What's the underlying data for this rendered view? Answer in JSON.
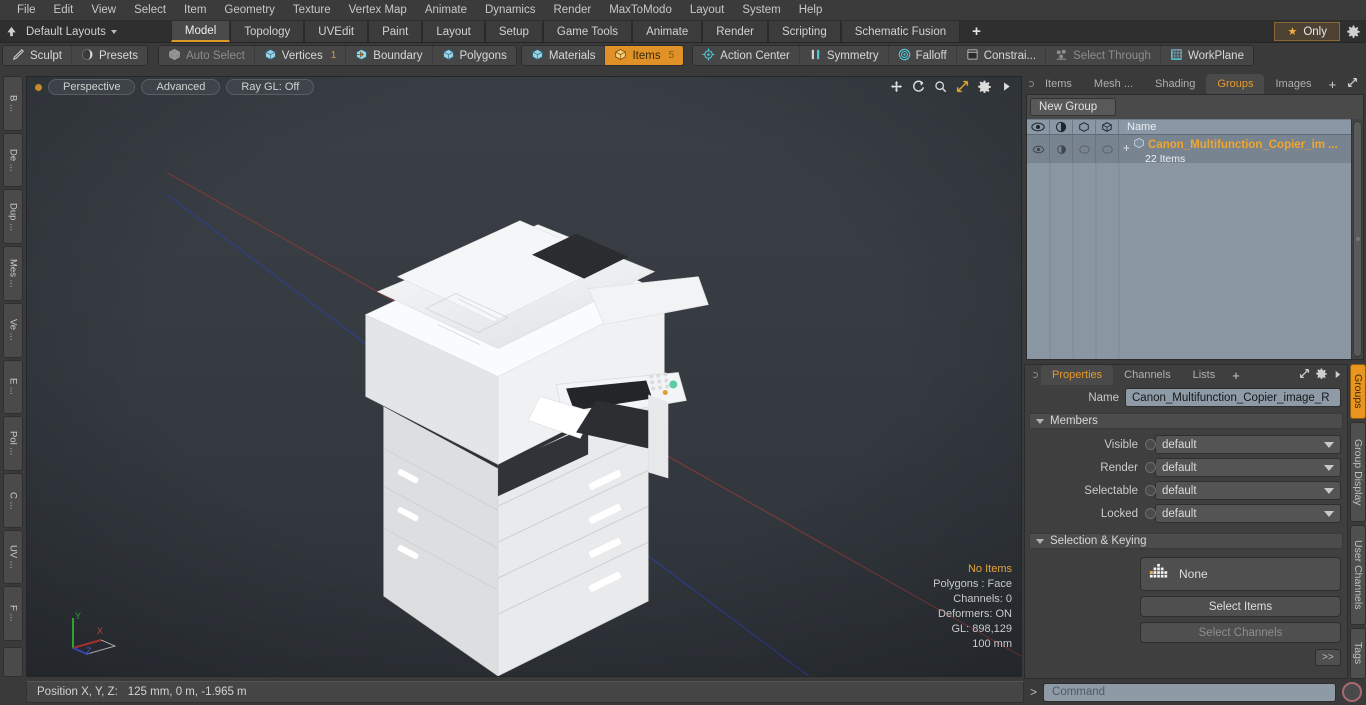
{
  "menubar": {
    "items": [
      "File",
      "Edit",
      "View",
      "Select",
      "Item",
      "Geometry",
      "Texture",
      "Vertex Map",
      "Animate",
      "Dynamics",
      "Render",
      "MaxToModo",
      "Layout",
      "System",
      "Help"
    ]
  },
  "layoutbar": {
    "preset_label": "Default Layouts",
    "tabs": [
      {
        "label": "Model",
        "active": true
      },
      {
        "label": "Topology",
        "active": false
      },
      {
        "label": "UVEdit",
        "active": false
      },
      {
        "label": "Paint",
        "active": false
      },
      {
        "label": "Layout",
        "active": false
      },
      {
        "label": "Setup",
        "active": false
      },
      {
        "label": "Game Tools",
        "active": false
      },
      {
        "label": "Animate",
        "active": false
      },
      {
        "label": "Render",
        "active": false
      },
      {
        "label": "Scripting",
        "active": false
      },
      {
        "label": "Schematic Fusion",
        "active": false
      }
    ],
    "add_label": "+",
    "only_label": "Only"
  },
  "toolbar": {
    "group1": [
      {
        "label": "Sculpt",
        "icon": "pencil-icon",
        "state": "normal"
      },
      {
        "label": "Presets",
        "icon": "sphere-icon",
        "state": "normal"
      }
    ],
    "group2": [
      {
        "label": "Auto Select",
        "icon": "cube-gray-icon",
        "state": "dim",
        "count": ""
      },
      {
        "label": "Vertices",
        "icon": "cube-blue-icon",
        "state": "normal",
        "count": "1"
      },
      {
        "label": "Boundary",
        "icon": "arrow-cube-icon",
        "state": "normal",
        "count": ""
      },
      {
        "label": "Polygons",
        "icon": "cube-blue-icon",
        "state": "normal",
        "count": ""
      }
    ],
    "group3": [
      {
        "label": "Materials",
        "icon": "cube-blue-icon",
        "state": "normal",
        "count": ""
      },
      {
        "label": "Items",
        "icon": "cube-orange-icon",
        "state": "selected",
        "count": "5"
      }
    ],
    "group4": [
      {
        "label": "Action Center",
        "icon": "target-icon",
        "state": "normal"
      },
      {
        "label": "Symmetry",
        "icon": "mirror-icon",
        "state": "normal"
      },
      {
        "label": "Falloff",
        "icon": "concentric-icon",
        "state": "normal"
      },
      {
        "label": "Constrai...",
        "icon": "plane-icon",
        "state": "normal"
      },
      {
        "label": "Select Through",
        "icon": "through-icon",
        "state": "dim"
      },
      {
        "label": "WorkPlane",
        "icon": "grid-icon",
        "state": "normal"
      }
    ]
  },
  "left_strip": {
    "tabs": [
      "B ...",
      "De ...",
      "Dup ...",
      "Mes ...",
      "Ve ...",
      "E ...",
      "Pol ...",
      "C ...",
      "UV ...",
      "F ..."
    ]
  },
  "viewport": {
    "projection": "Perspective",
    "shading": "Advanced",
    "raygl": "Ray GL: Off",
    "header_icons": [
      "move-icon",
      "rotate-icon",
      "zoom-icon",
      "fit-icon",
      "gear-icon",
      "play-icon"
    ],
    "info": {
      "items": "No Items",
      "polygons": "Polygons : Face",
      "channels": "Channels: 0",
      "deformers": "Deformers: ON",
      "gl": "GL: 898,129",
      "scale": "100 mm"
    },
    "axis": {
      "x": "X",
      "y": "Y",
      "z": "Z"
    },
    "bg_color": "#343a40"
  },
  "right_panel": {
    "tabs": [
      {
        "label": "Items",
        "active": false
      },
      {
        "label": "Mesh ...",
        "active": false
      },
      {
        "label": "Shading",
        "active": false
      },
      {
        "label": "Groups",
        "active": true
      },
      {
        "label": "Images",
        "active": false
      }
    ],
    "add_label": "+",
    "new_group_label": "New Group",
    "list": {
      "column_icons": [
        "eye-icon",
        "render-icon",
        "cube-outline-icon",
        "cube-wire-icon"
      ],
      "name_header": "Name",
      "rows": [
        {
          "name": "Canon_Multifunction_Copier_im ...",
          "sub": "22 Items",
          "expand": "+"
        }
      ]
    }
  },
  "properties": {
    "tabs": [
      {
        "label": "Properties",
        "active": true
      },
      {
        "label": "Channels",
        "active": false
      },
      {
        "label": "Lists",
        "active": false
      }
    ],
    "add_label": "+",
    "name_label": "Name",
    "name_value": "Canon_Multifunction_Copier_image_R",
    "members_section": "Members",
    "members": [
      {
        "label": "Visible",
        "value": "default"
      },
      {
        "label": "Render",
        "value": "default"
      },
      {
        "label": "Selectable",
        "value": "default"
      },
      {
        "label": "Locked",
        "value": "default"
      }
    ],
    "selection_section": "Selection & Keying",
    "keying_value": "None",
    "select_items_label": "Select Items",
    "select_channels_label": "Select Channels",
    "more_label": ">>"
  },
  "right_vtabs": [
    {
      "label": "Groups",
      "active": true
    },
    {
      "label": "Group Display",
      "active": false
    },
    {
      "label": "User Channels",
      "active": false
    },
    {
      "label": "Tags",
      "active": false
    }
  ],
  "statusbar": {
    "position_label": "Position X, Y, Z:",
    "position_value": "125 mm, 0 m, -1.965 m",
    "command_chevron": ">",
    "command_placeholder": "Command"
  },
  "colors": {
    "accent": "#e09127",
    "panel": "#4a4a4a",
    "list_row": "#78848f",
    "field": "#8e9aa5"
  }
}
